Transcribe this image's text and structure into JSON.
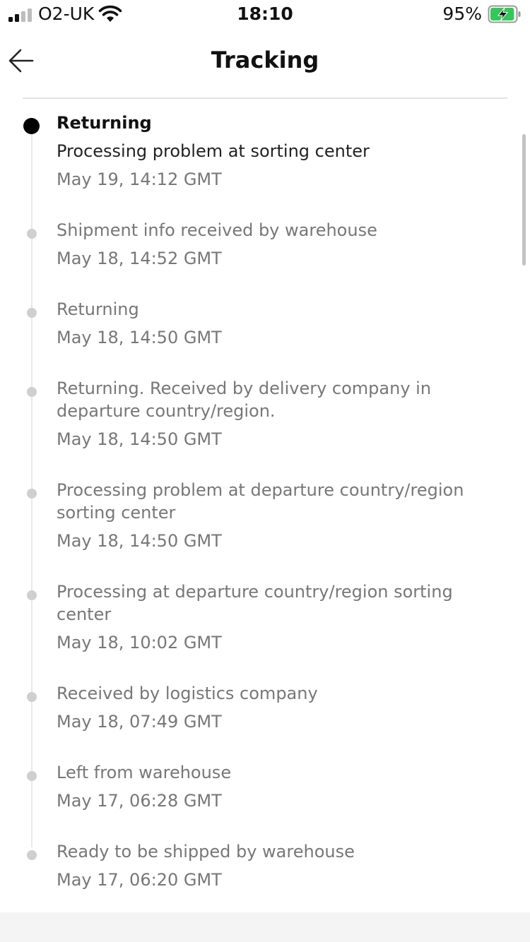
{
  "status_bar": {
    "carrier": "O2-UK",
    "time": "18:10",
    "battery_percent": "95%",
    "battery_level": 0.95,
    "signal_bars": 2,
    "signal_bars_total": 4,
    "charging": true
  },
  "header": {
    "title": "Tracking",
    "back_icon": "arrow-left-icon"
  },
  "colors": {
    "current_dot": "#000000",
    "past_dot": "#cfcfcf",
    "battery_fill": "#34c759"
  },
  "tracking": {
    "events": [
      {
        "status": "Returning",
        "description": "Processing problem at sorting center",
        "time": "May 19, 14:12 GMT",
        "current": true
      },
      {
        "description": "Shipment info received by warehouse",
        "time": "May 18, 14:52 GMT"
      },
      {
        "description": "Returning",
        "time": "May 18, 14:50 GMT"
      },
      {
        "description": "Returning. Received by delivery company in departure country/region.",
        "time": "May 18, 14:50 GMT"
      },
      {
        "description": "Processing problem at departure country/region sorting center",
        "time": "May 18, 14:50 GMT"
      },
      {
        "description": "Processing at departure country/region sorting center",
        "time": "May 18, 10:02 GMT"
      },
      {
        "description": "Received by logistics company",
        "time": "May 18, 07:49 GMT"
      },
      {
        "description": "Left from warehouse",
        "time": "May 17, 06:28 GMT"
      },
      {
        "description": "Ready to be shipped by warehouse",
        "time": "May 17, 06:20 GMT"
      }
    ]
  }
}
